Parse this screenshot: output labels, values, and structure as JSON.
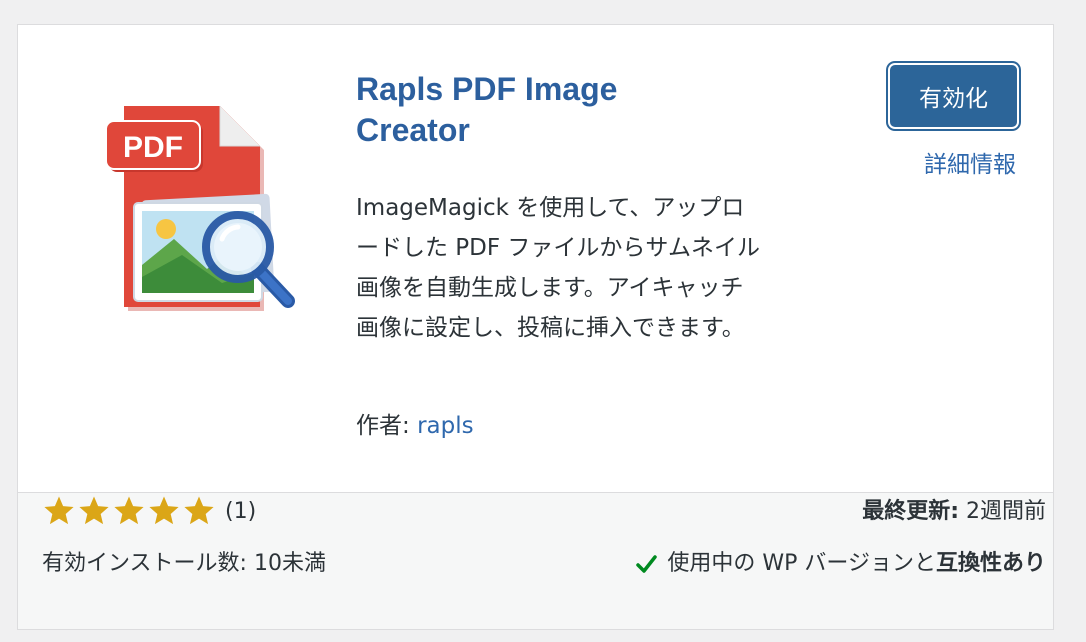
{
  "plugin": {
    "title": "Rapls PDF Image Creator",
    "description": "ImageMagick を使用して、アップロードした PDF ファイルからサムネイル画像を自動生成します。アイキャッチ画像に設定し、投稿に挿入できます。",
    "author_label": "作者: ",
    "author_name": "rapls",
    "icon_badge_text": "PDF"
  },
  "actions": {
    "activate_label": "有効化",
    "more_details_label": "詳細情報"
  },
  "footer": {
    "rating": {
      "stars": 5,
      "max": 5,
      "count_text": "(1)"
    },
    "installs_text": "有効インストール数: 10未満",
    "last_updated_label": "最終更新:",
    "last_updated_value": " 2週間前",
    "compat_prefix": "使用中の WP バージョンと",
    "compat_strong": "互換性あり"
  },
  "colors": {
    "accent": "#2c6599",
    "link": "#2f68ad",
    "star": "#dba617",
    "check": "#008a20",
    "pdf_red": "#e0473a"
  },
  "icons": {
    "plugin_icon": "pdf-image-search-icon",
    "star": "star-icon",
    "check": "checkmark-icon"
  }
}
